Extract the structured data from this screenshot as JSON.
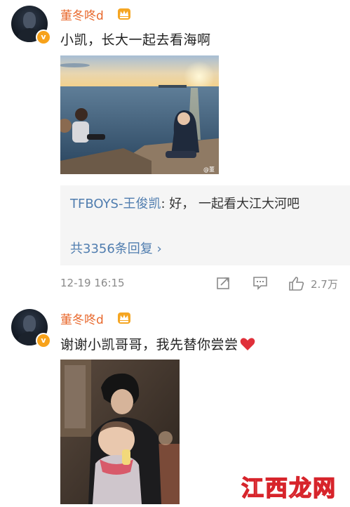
{
  "posts": [
    {
      "username": "董冬咚d",
      "text": "小凯，长大一起去看海啊",
      "photo_watermark": "@董",
      "reply": {
        "author": "TFBOYS-王俊凯",
        "text": ": 好，  一起看大江大河吧",
        "count_label": "共3356条回复 ›"
      },
      "time": "12-19 16:15",
      "like_count": "2.7万"
    },
    {
      "username": "董冬咚d",
      "text": "谢谢小凯哥哥，我先替你尝尝"
    }
  ],
  "site_watermark": "江西龙网",
  "colors": {
    "username": "#e8682c",
    "link": "#507daf",
    "badge": "#f7a21b"
  }
}
